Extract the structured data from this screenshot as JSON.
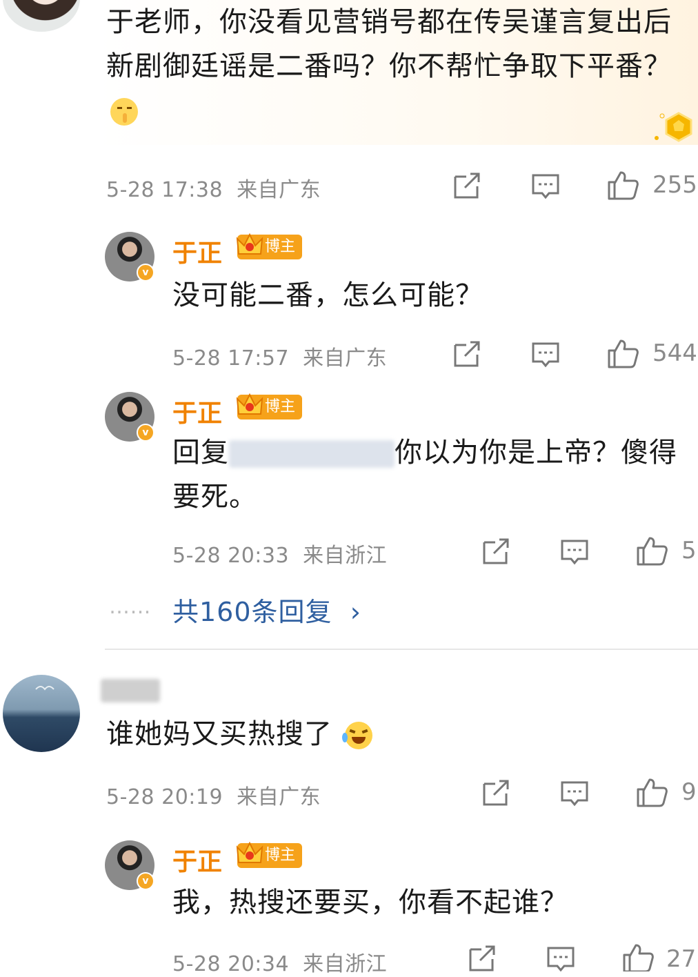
{
  "top_comment": {
    "text": "于老师，你没看见营销号都在传吴谨言复出后新剧御廷谣是二番吗？你不帮忙争取下平番？",
    "emoji": "shush-emoji",
    "time": "5-28 17:38",
    "source": "来自广东",
    "likes": "255"
  },
  "reply_1": {
    "name": "于正",
    "badge": "博主",
    "text": "没可能二番，怎么可能？",
    "time": "5-28 17:57",
    "source": "来自广东",
    "likes": "544"
  },
  "reply_2": {
    "name": "于正",
    "badge": "博主",
    "prefix": "回复",
    "text": "你以为你是上帝？傻得要死。",
    "time": "5-28 20:33",
    "source": "来自浙江",
    "likes": "5"
  },
  "more_replies": {
    "dots": "……",
    "label": "共160条回复",
    "chevron": "›"
  },
  "second_comment": {
    "text": "谁她妈又买热搜了",
    "emoji": "laugh-cry-emoji",
    "time": "5-28 20:19",
    "source": "来自广东",
    "likes": "9"
  },
  "reply_3": {
    "name": "于正",
    "badge": "博主",
    "text": "我，热搜还要买，你看不起谁？",
    "time": "5-28 20:34",
    "source": "来自浙江",
    "likes": "27"
  },
  "colors": {
    "name": "#f08200",
    "badge": "#f6a21a",
    "link": "#2f5fa0",
    "meta": "#8a8a8a"
  }
}
